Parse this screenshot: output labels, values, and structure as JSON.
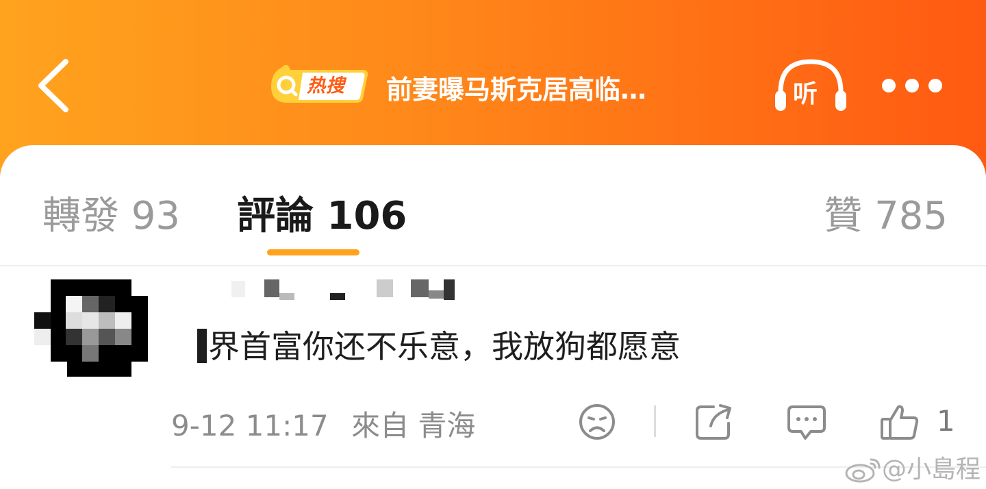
{
  "header": {
    "hot_badge": "热搜",
    "title": "前妻曝马斯克居高临…",
    "listen_label": "听",
    "colors": {
      "start": "#ffa31e",
      "end": "#ff5a12"
    }
  },
  "tabs": {
    "repost": "轉發 93",
    "comment": "評論 106",
    "like": "贊 785",
    "active": "comment",
    "underline_color": "#ffa31e"
  },
  "comment": {
    "text": "界首富你还不乐意，我放狗都愿意",
    "time": "9-12 11:17",
    "location": "來自 青海",
    "like_count": "1",
    "actions": [
      "dislike-face-icon",
      "share-icon",
      "reply-bubble-icon",
      "thumbs-up-icon"
    ]
  },
  "watermark": {
    "handle": "@小島程"
  }
}
